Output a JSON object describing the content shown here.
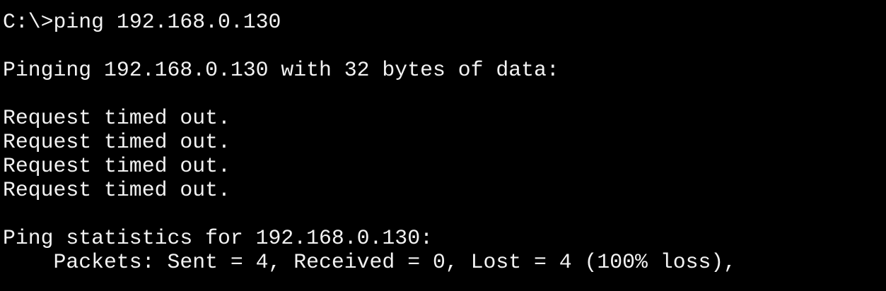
{
  "terminal": {
    "background_color": "#000000",
    "text_color": "#f2f2f2",
    "prompt": "C:\\>",
    "command": "ping 192.168.0.130",
    "pinging_line": "Pinging 192.168.0.130 with 32 bytes of data:",
    "replies": [
      "Request timed out.",
      "Request timed out.",
      "Request timed out.",
      "Request timed out."
    ],
    "statistics_header": "Ping statistics for 192.168.0.130:",
    "packets_line": "    Packets: Sent = 4, Received = 0, Lost = 4 (100% loss),"
  }
}
